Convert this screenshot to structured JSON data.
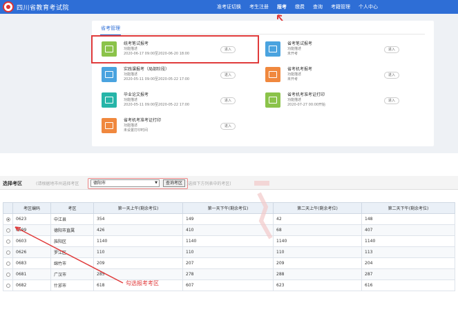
{
  "navbar": {
    "logo_text": "四川省教育考试院",
    "items": [
      "准考证切换",
      "考生注册",
      "报考",
      "缴费",
      "查询",
      "考籍管理",
      "个人中心"
    ],
    "active_index": 2
  },
  "card": {
    "tab_label": "省考管理",
    "exams": [
      {
        "title": "统考笔试报考",
        "desc": "功能描述",
        "time": "2020-06-17 09:00至2020-06-20 18:00",
        "button": "进入",
        "color": "#8bc34a"
      },
      {
        "title": "省考笔试报考",
        "desc": "功能描述",
        "time": "未开考",
        "button": "进入",
        "color": "#4aa3df"
      },
      {
        "title": "实践课报考（局部阶段）",
        "desc": "功能描述",
        "time": "2020-05-11 09:00至2020-05-22 17:00",
        "button": "进入",
        "color": "#4aa3df"
      },
      {
        "title": "省考机考报考",
        "desc": "功能描述",
        "time": "未开考",
        "button": "进入",
        "color": "#f0883e"
      },
      {
        "title": "毕业论文报考",
        "desc": "功能描述",
        "time": "2020-05-11 09:00至2020-05-22 17:00",
        "button": "进入",
        "color": "#26b5a8"
      },
      {
        "title": "省考机考准考证打印",
        "desc": "功能描述",
        "time": "2020-07-27 00:00开始",
        "button": "进入",
        "color": "#8bc34a"
      },
      {
        "title": "省考机考准考证打印",
        "desc": "功能描述",
        "time": "未设置打印时间",
        "button": "进入",
        "color": "#f0883e"
      }
    ]
  },
  "selector": {
    "label": "选择考区",
    "hint1": "(请根据地市州选择考区",
    "selected_city": "德阳市",
    "button": "查询考区",
    "hint2": ")选择下方列表中的考区("
  },
  "table": {
    "headers": [
      "",
      "考区编码",
      "考区",
      "第一天上午(剩余考位)",
      "第一天下午(剩余考位)",
      "第二天上午(剩余考位)",
      "第二天下午(剩余考位)"
    ],
    "rows": [
      {
        "code": "0623",
        "name": "中江县",
        "d1am": "354",
        "d1pm": "149",
        "d2am": "42",
        "d2pm": "148",
        "selected": true
      },
      {
        "code": "0699",
        "name": "德阳市直属",
        "d1am": "426",
        "d1pm": "410",
        "d2am": "68",
        "d2pm": "407",
        "selected": false
      },
      {
        "code": "0603",
        "name": "旌阳区",
        "d1am": "1140",
        "d1pm": "1140",
        "d2am": "1140",
        "d2pm": "1140",
        "selected": false
      },
      {
        "code": "0626",
        "name": "罗江区",
        "d1am": "110",
        "d1pm": "110",
        "d2am": "110",
        "d2pm": "113",
        "selected": false
      },
      {
        "code": "0683",
        "name": "绵竹市",
        "d1am": "209",
        "d1pm": "207",
        "d2am": "209",
        "d2pm": "204",
        "selected": false
      },
      {
        "code": "0681",
        "name": "广汉市",
        "d1am": "285",
        "d1pm": "278",
        "d2am": "288",
        "d2pm": "287",
        "selected": false
      },
      {
        "code": "0682",
        "name": "什邡市",
        "d1am": "618",
        "d1pm": "607",
        "d2am": "623",
        "d2pm": "616",
        "selected": false
      }
    ]
  },
  "annotation": "勾选报考考区"
}
